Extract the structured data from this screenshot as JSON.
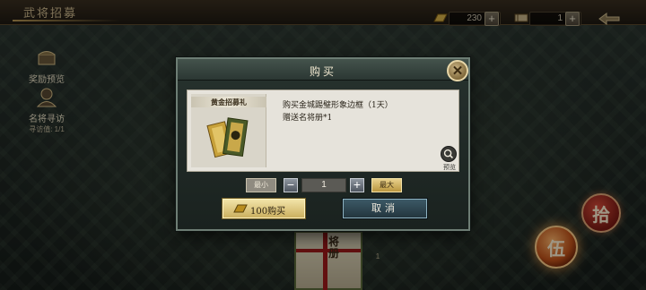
{
  "header": {
    "title": "武将招募",
    "resources": [
      {
        "icon": "gold-bar-icon",
        "value": "230"
      },
      {
        "icon": "scroll-ticket-icon",
        "value": "1"
      }
    ]
  },
  "side_menu": [
    {
      "label": "奖励预览",
      "icon": "reward-chest-icon"
    },
    {
      "label": "名将寻访",
      "sub_label": "寻访值: 1/1",
      "icon": "general-portrait-icon"
    }
  ],
  "right_buttons": {
    "ten_label": "拾",
    "five_label": "伍"
  },
  "background_book": {
    "title": "将册",
    "count": "1"
  },
  "modal": {
    "title": "购买",
    "gift_name": "黄金招募礼",
    "desc_line1": "购买金城踢璧形象边框（1天）",
    "desc_line2": "赠送名将册*1",
    "preview_label": "预览",
    "quantity": {
      "min_label": "最小",
      "value": "1",
      "max_label": "最大"
    },
    "buy_label": "100购买",
    "cancel_label": "取消"
  },
  "colors": {
    "accent_gold": "#cbb060",
    "cancel_blue": "#3c5966",
    "modal_frame": "#27322e"
  }
}
